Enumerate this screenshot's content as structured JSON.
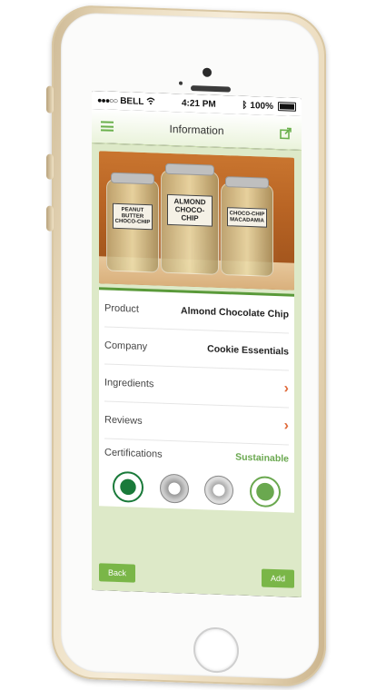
{
  "statusbar": {
    "carrier": "BELL",
    "time": "4:21 PM",
    "battery": "100%"
  },
  "navbar": {
    "title": "Information"
  },
  "photo": {
    "jars": [
      {
        "label": "PEANUT BUTTER CHOCO-CHIP"
      },
      {
        "label": "ALMOND CHOCO-CHIP"
      },
      {
        "label": "CHOCO-CHIP MACADAMIA"
      }
    ]
  },
  "details": [
    {
      "label": "Product",
      "value": "Almond Chocolate Chip"
    },
    {
      "label": "Company",
      "value": "Cookie Essentials"
    },
    {
      "label": "Ingredients",
      "value": ""
    },
    {
      "label": "Reviews",
      "value": ""
    },
    {
      "label": "Certifications",
      "value": "Sustainable"
    }
  ],
  "badges": [
    "rspo-certified-icon",
    "certification-seal-icon",
    "certification-seal-icon",
    "greenpalm-sustainability-icon"
  ],
  "footer": {
    "back_label": "Back",
    "add_label": "Add"
  },
  "colors": {
    "accent": "#7ab648",
    "chevron": "#e06a3a",
    "screen_bg": "#dde9c8"
  }
}
